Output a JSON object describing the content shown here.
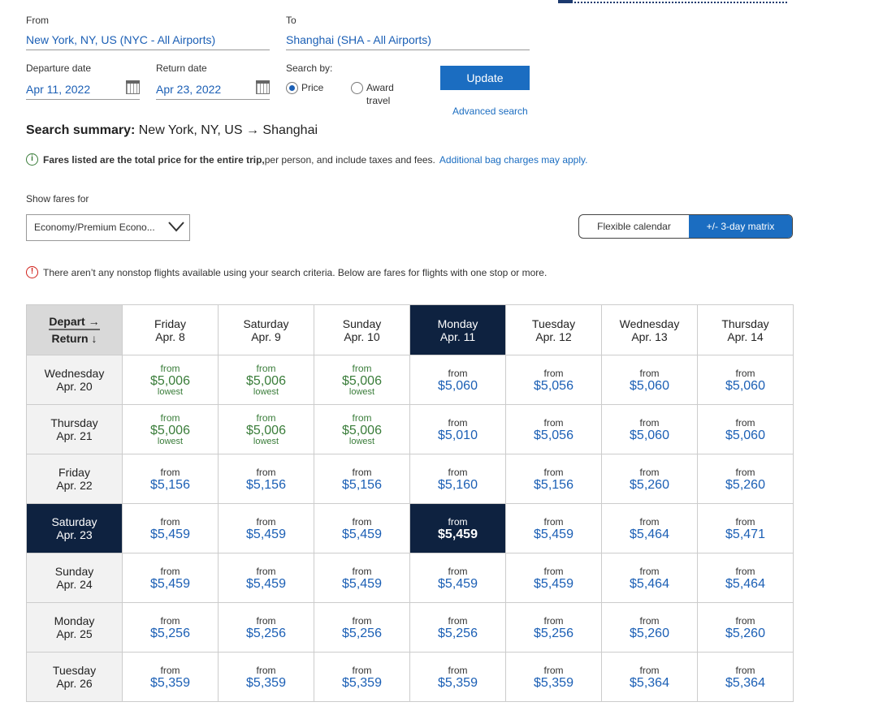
{
  "search": {
    "from_label": "From",
    "from_value": "New York, NY, US (NYC - All Airports)",
    "to_label": "To",
    "to_value": "Shanghai (SHA - All Airports)",
    "departure_label": "Departure date",
    "departure_value": "Apr 11, 2022",
    "return_label": "Return date",
    "return_value": "Apr 23, 2022",
    "search_by_label": "Search by:",
    "option_price": "Price",
    "option_award_line1": "Award",
    "option_award_line2": "travel",
    "update_button": "Update",
    "advanced_link": "Advanced search"
  },
  "summary": {
    "heading": "Search summary:",
    "route": "New York, NY, US → Shanghai",
    "info_bold": "Fares listed are the total price for the entire trip,",
    "info_rest": " per person, and include taxes and fees.",
    "info_link": "Additional bag charges may apply.",
    "info_icon": "i"
  },
  "filters": {
    "show_fares_label": "Show fares for",
    "cabin_value": "Economy/Premium Econo...",
    "view_flexible": "Flexible calendar",
    "view_matrix": "+/- 3-day matrix"
  },
  "warning": {
    "icon": "!",
    "text": "There aren’t any nonstop flights available using your search criteria. Below are fares for flights with one stop or more."
  },
  "matrix": {
    "corner_depart": "Depart →",
    "corner_return": "Return ↓",
    "from_label": "from",
    "lowest_label": "lowest",
    "depart_days": [
      {
        "day": "Friday",
        "date": "Apr. 8"
      },
      {
        "day": "Saturday",
        "date": "Apr. 9"
      },
      {
        "day": "Sunday",
        "date": "Apr. 10"
      },
      {
        "day": "Monday",
        "date": "Apr. 11",
        "selected": true
      },
      {
        "day": "Tuesday",
        "date": "Apr. 12"
      },
      {
        "day": "Wednesday",
        "date": "Apr. 13"
      },
      {
        "day": "Thursday",
        "date": "Apr. 14"
      }
    ],
    "rows": [
      {
        "day": "Wednesday",
        "date": "Apr. 20",
        "prices": [
          "$5,006",
          "$5,006",
          "$5,006",
          "$5,060",
          "$5,056",
          "$5,060",
          "$5,060"
        ],
        "lowest": [
          true,
          true,
          true,
          false,
          false,
          false,
          false
        ]
      },
      {
        "day": "Thursday",
        "date": "Apr. 21",
        "prices": [
          "$5,006",
          "$5,006",
          "$5,006",
          "$5,010",
          "$5,056",
          "$5,060",
          "$5,060"
        ],
        "lowest": [
          true,
          true,
          true,
          false,
          false,
          false,
          false
        ]
      },
      {
        "day": "Friday",
        "date": "Apr. 22",
        "prices": [
          "$5,156",
          "$5,156",
          "$5,156",
          "$5,160",
          "$5,156",
          "$5,260",
          "$5,260"
        ],
        "lowest": [
          false,
          false,
          false,
          false,
          false,
          false,
          false
        ]
      },
      {
        "day": "Saturday",
        "date": "Apr. 23",
        "selected": true,
        "prices": [
          "$5,459",
          "$5,459",
          "$5,459",
          "$5,459",
          "$5,459",
          "$5,464",
          "$5,471"
        ],
        "lowest": [
          false,
          false,
          false,
          false,
          false,
          false,
          false
        ]
      },
      {
        "day": "Sunday",
        "date": "Apr. 24",
        "prices": [
          "$5,459",
          "$5,459",
          "$5,459",
          "$5,459",
          "$5,459",
          "$5,464",
          "$5,464"
        ],
        "lowest": [
          false,
          false,
          false,
          false,
          false,
          false,
          false
        ]
      },
      {
        "day": "Monday",
        "date": "Apr. 25",
        "prices": [
          "$5,256",
          "$5,256",
          "$5,256",
          "$5,256",
          "$5,256",
          "$5,260",
          "$5,260"
        ],
        "lowest": [
          false,
          false,
          false,
          false,
          false,
          false,
          false
        ]
      },
      {
        "day": "Tuesday",
        "date": "Apr. 26",
        "prices": [
          "$5,359",
          "$5,359",
          "$5,359",
          "$5,359",
          "$5,359",
          "$5,364",
          "$5,364"
        ],
        "lowest": [
          false,
          false,
          false,
          false,
          false,
          false,
          false
        ]
      }
    ]
  },
  "colors": {
    "accent": "#1b6dc1",
    "selected_bg": "#0e2240",
    "lowest_green": "#3a7d3a",
    "warning_red": "#d0201a"
  }
}
